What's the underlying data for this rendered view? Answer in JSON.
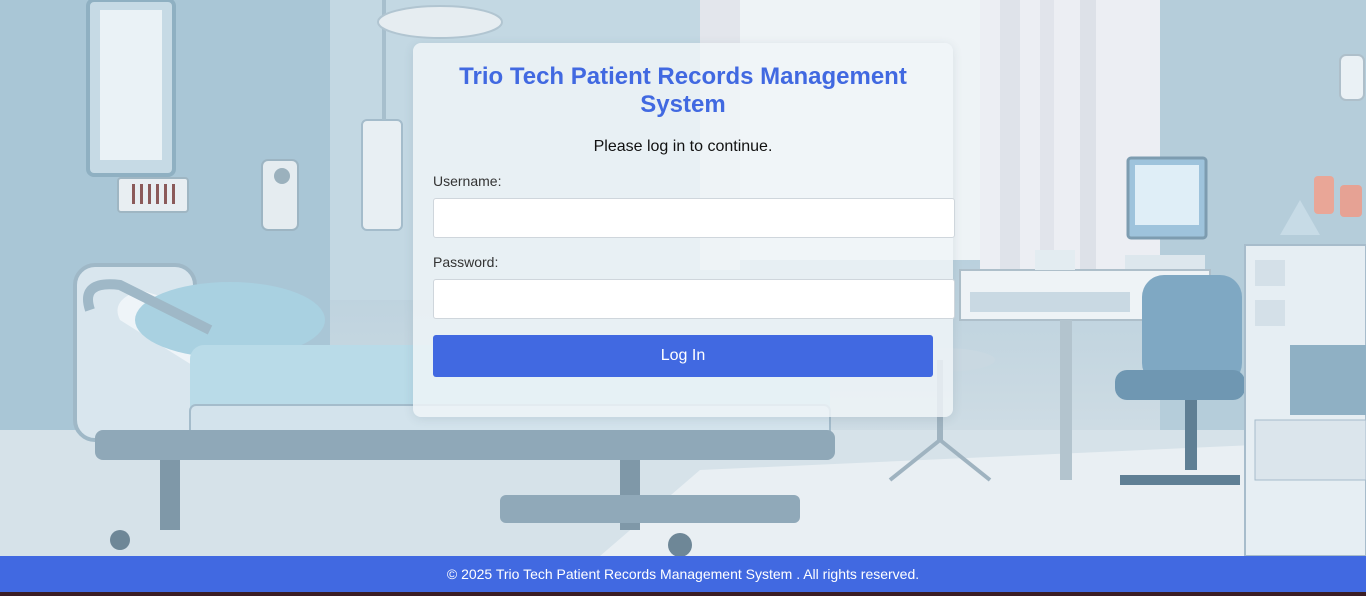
{
  "login": {
    "title": "Trio Tech Patient Records Management System",
    "subtitle": "Please log in to continue.",
    "username_label": "Username:",
    "username_value": "",
    "password_label": "Password:",
    "password_value": "",
    "submit_label": "Log In"
  },
  "footer": {
    "text": "© 2025 Trio Tech Patient Records Management System . All rights reserved."
  },
  "colors": {
    "accent": "#4169e1",
    "card_background": "rgba(240,245,248,0.82)",
    "footer_text": "#ffffff"
  }
}
